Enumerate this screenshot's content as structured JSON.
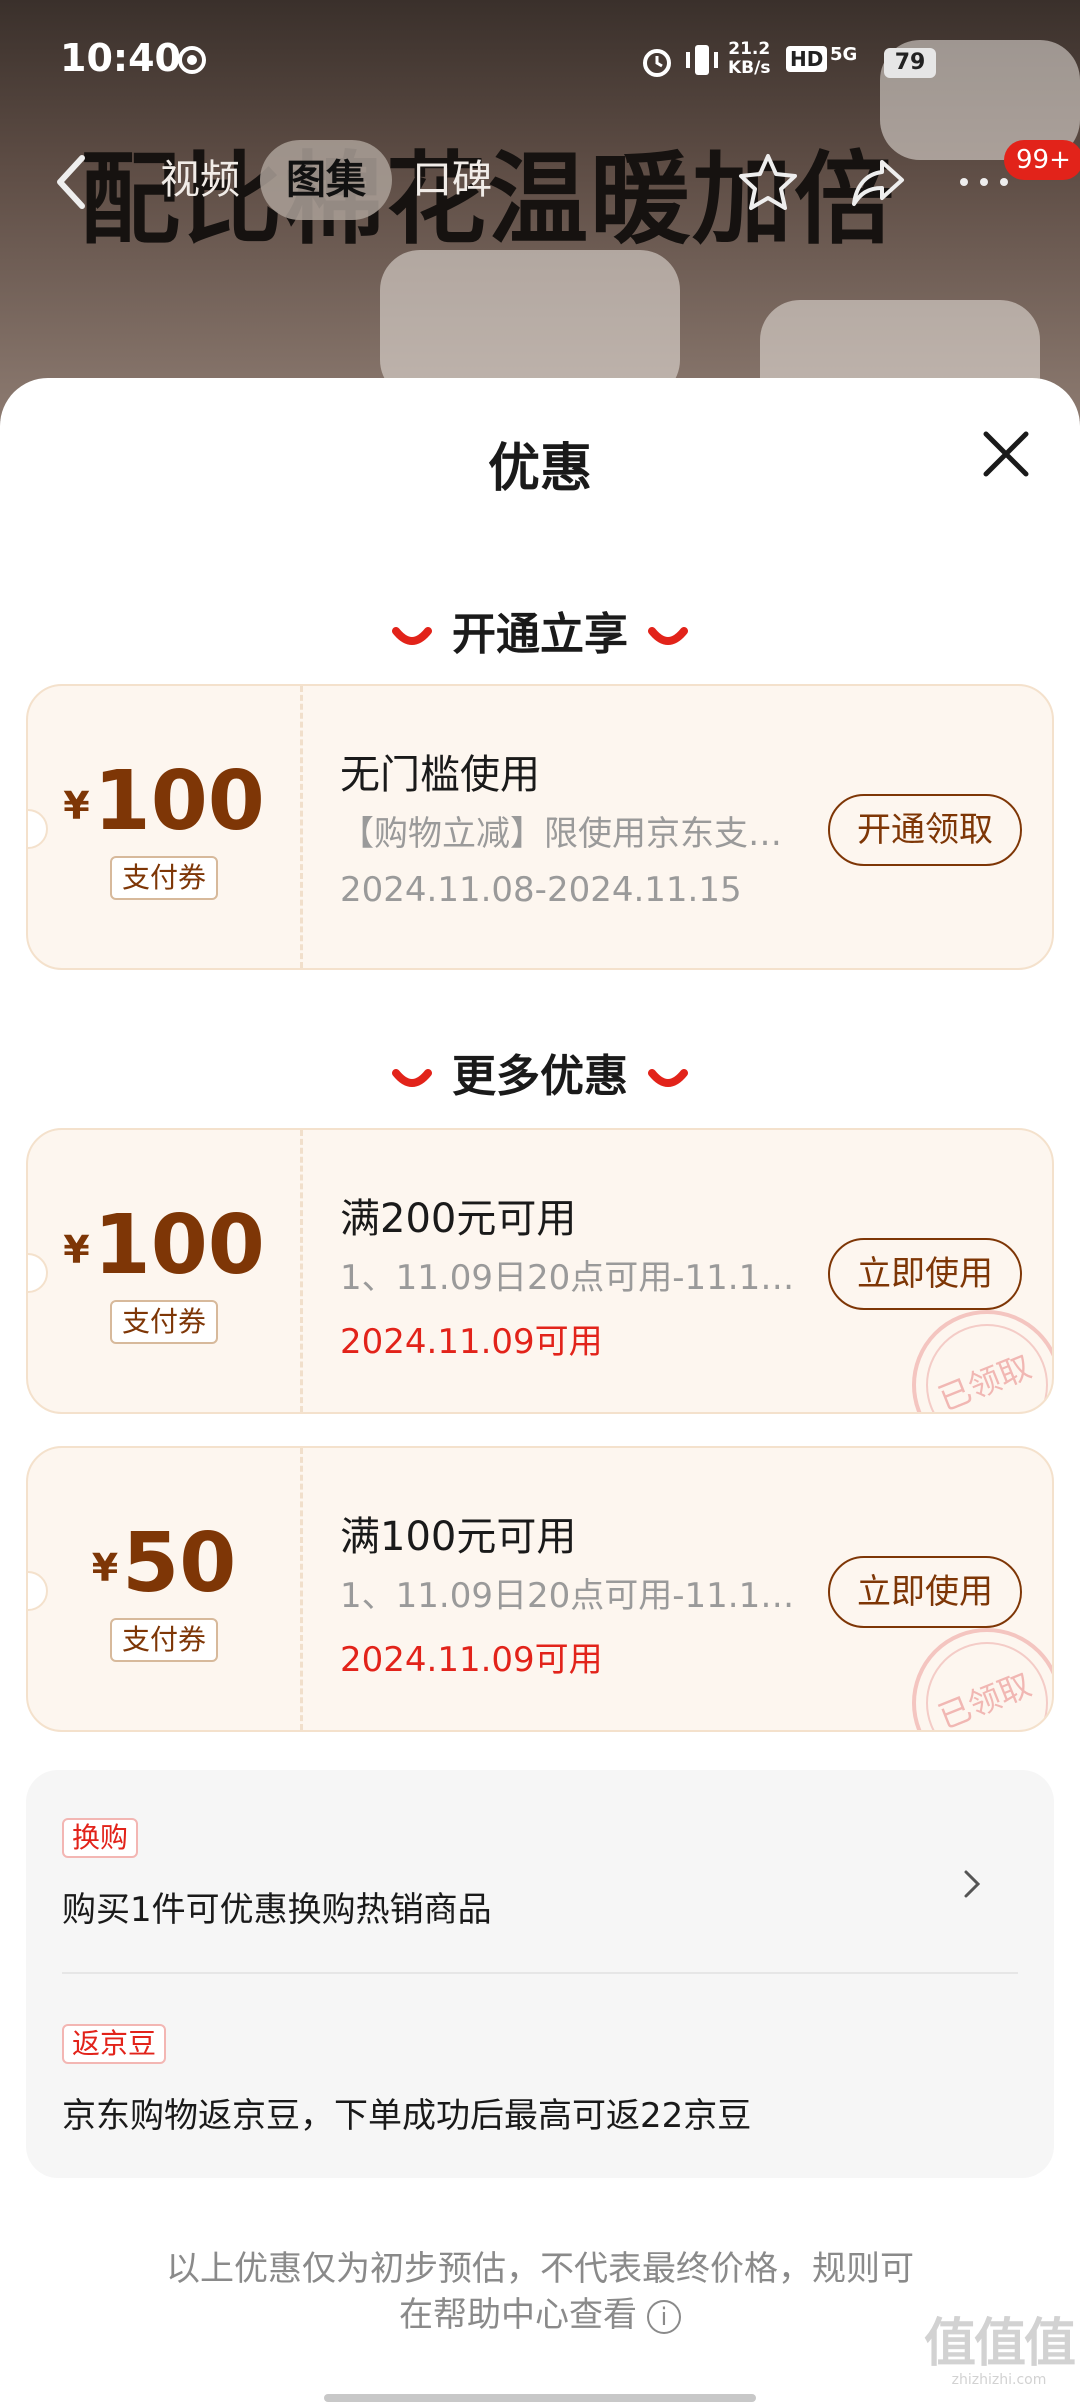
{
  "status_bar": {
    "time": "10:40",
    "net_speed": "21.2",
    "net_unit": "KB/s",
    "hd": "HD",
    "signal": "5G",
    "battery": "79"
  },
  "background": {
    "banner": "配比棉花温暖加倍"
  },
  "nav": {
    "tabs": [
      "视频",
      "图集",
      "口碑"
    ],
    "active_tab": "图集",
    "badge": "99+"
  },
  "sheet": {
    "title": "优惠"
  },
  "sections": {
    "open": "开通立享",
    "more": "更多优惠"
  },
  "coupons": [
    {
      "yen": "¥",
      "amount": "100",
      "tag": "支付券",
      "title": "无门槛使用",
      "desc": "【购物立减】限使用京东支付…",
      "date": "2024.11.08-2024.11.15",
      "button": "开通领取"
    },
    {
      "yen": "¥",
      "amount": "100",
      "tag": "支付券",
      "title": "满200元可用",
      "desc": "1、11.09日20点可用-11.11…",
      "date": "2024.11.09可用",
      "button": "立即使用",
      "stamp": "已领取"
    },
    {
      "yen": "¥",
      "amount": "50",
      "tag": "支付券",
      "title": "满100元可用",
      "desc": "1、11.09日20点可用-11.11…",
      "date": "2024.11.09可用",
      "button": "立即使用",
      "stamp": "已领取"
    }
  ],
  "extras": [
    {
      "tag": "换购",
      "text": "购买1件可优惠换购热销商品"
    },
    {
      "tag": "返京豆",
      "text": "京东购物返京豆，下单成功后最高可返22京豆"
    }
  ],
  "disclaimer": {
    "line1": "以上优惠仅为初步预估，不代表最终价格，规则可",
    "line2": "在帮助中心查看",
    "info_icon": "i"
  },
  "watermark": {
    "big": "值值值",
    "small": "zhizhizhi.com"
  },
  "colors": {
    "accent": "#e2231a",
    "coupon_brown": "#7e3606",
    "coupon_bg": "#fdf6ef"
  }
}
